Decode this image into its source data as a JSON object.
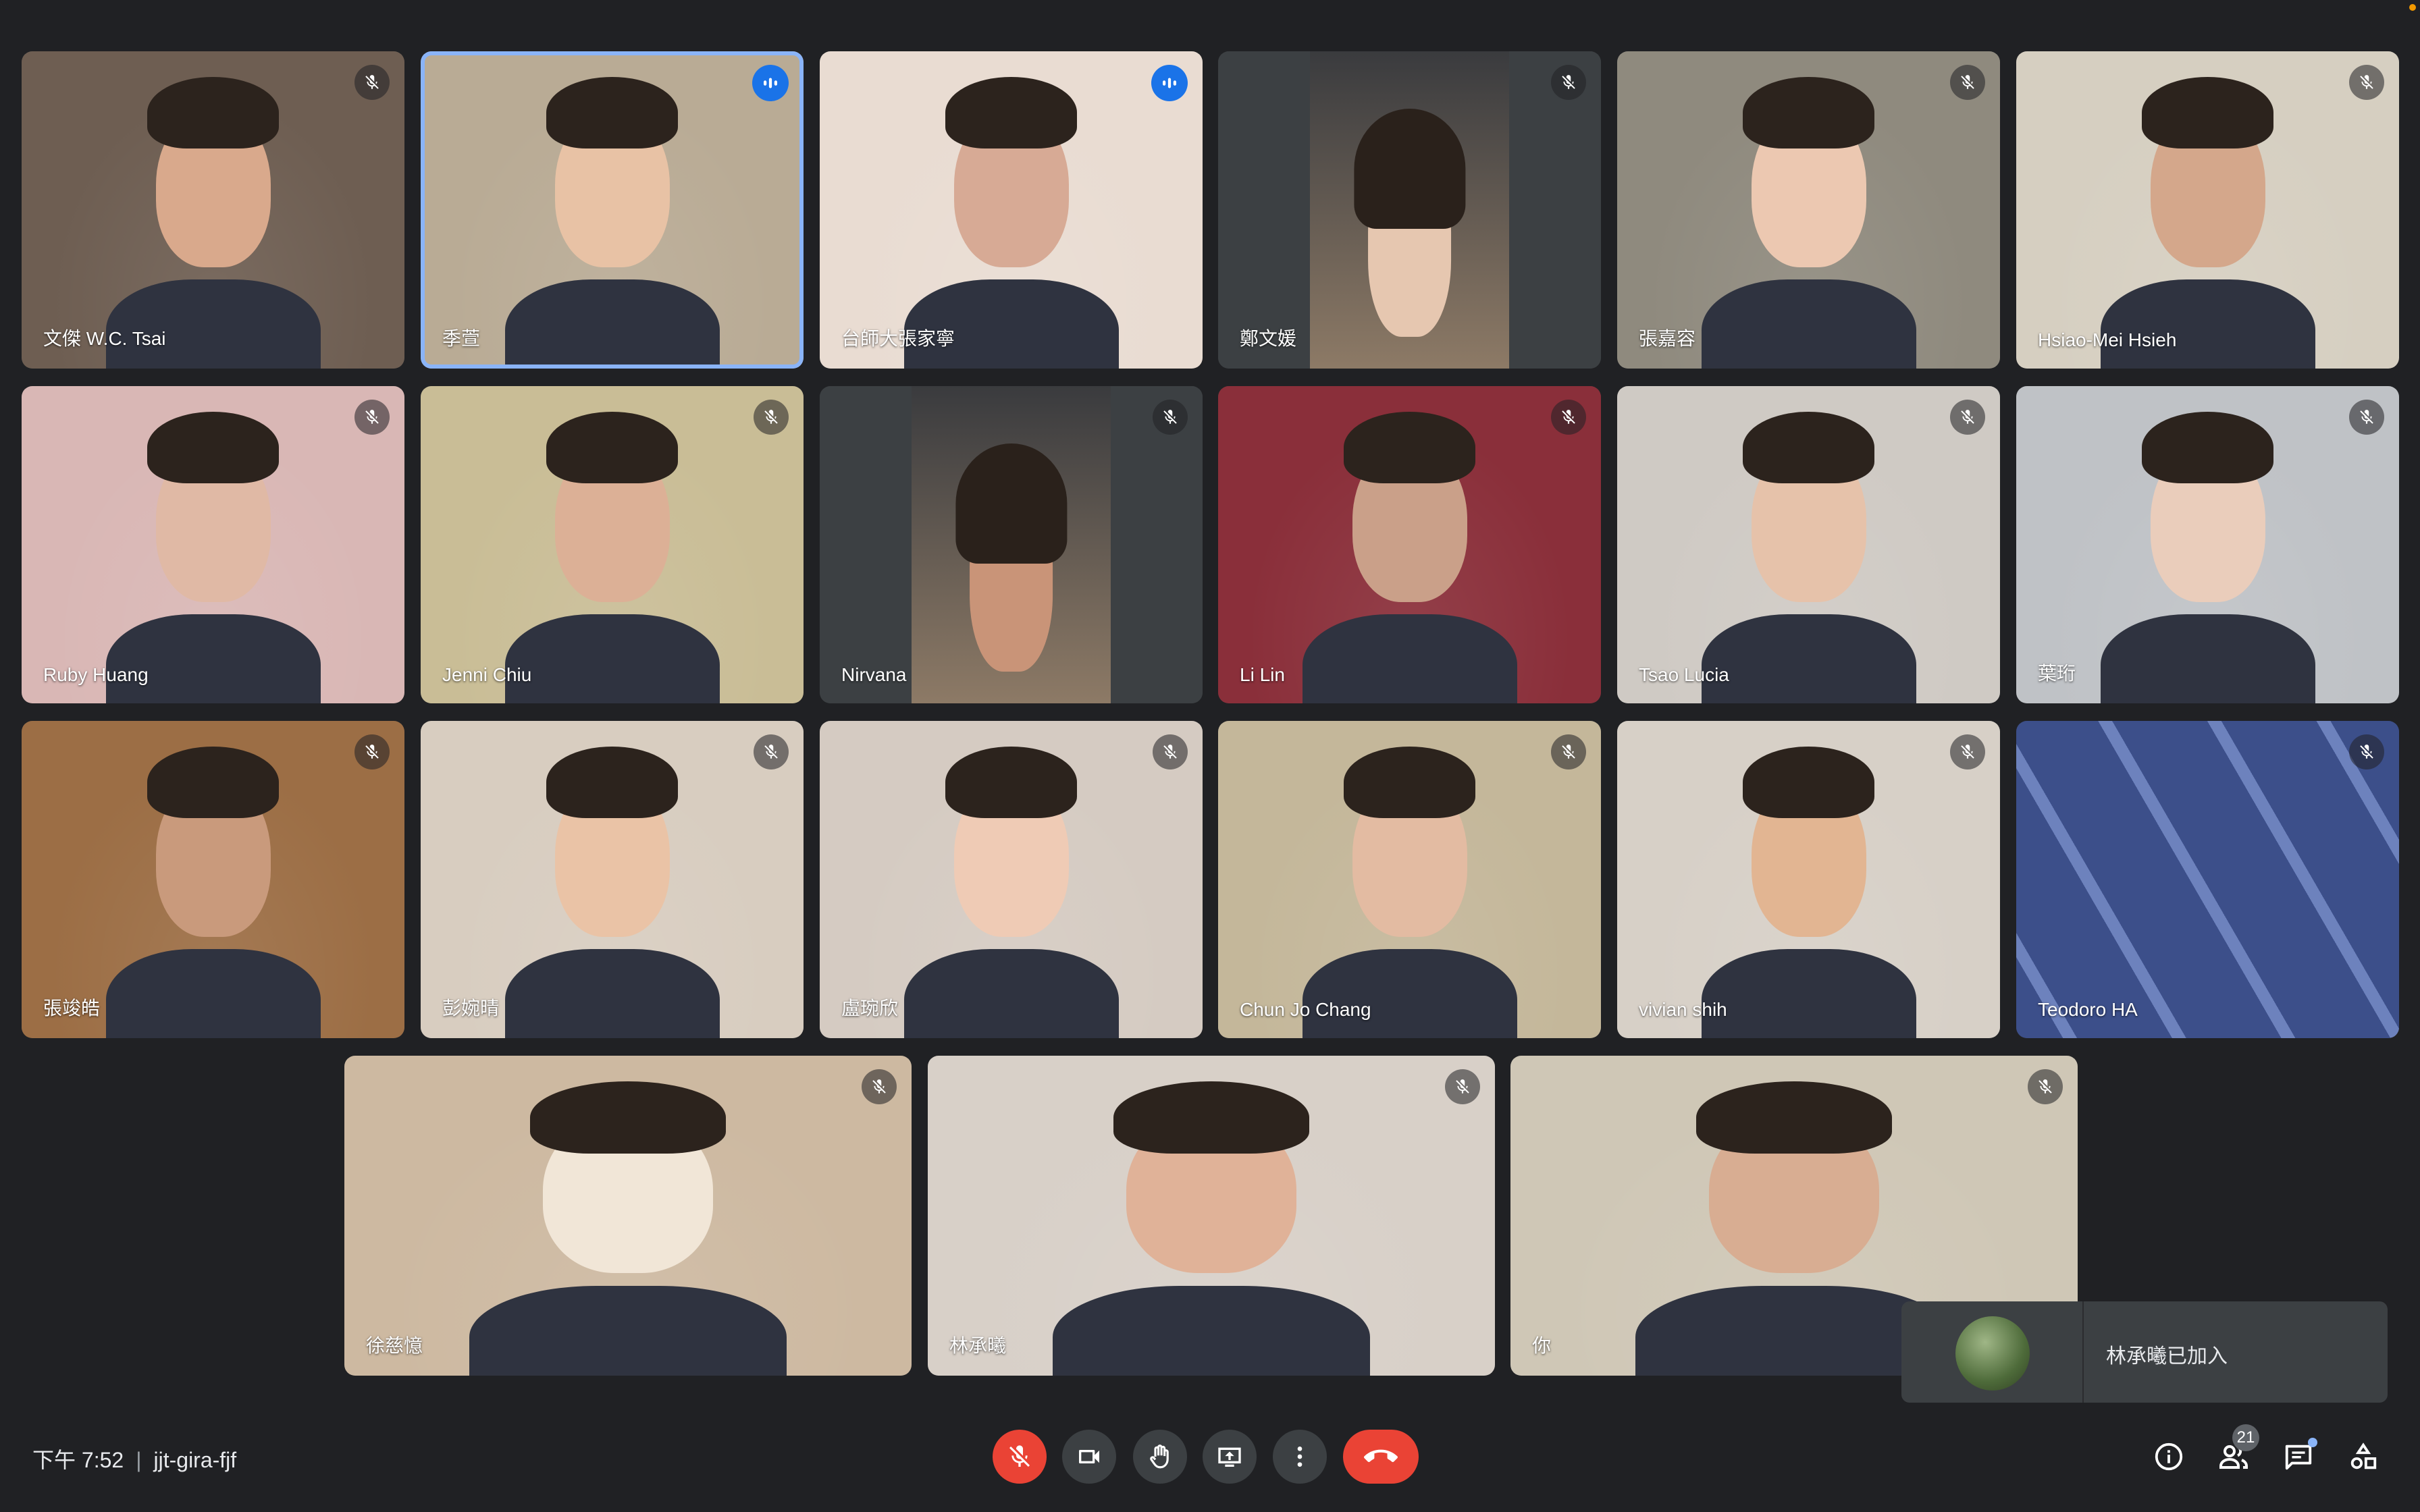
{
  "participants": [
    {
      "name": "文傑 W.C. Tsai",
      "bg": "#6e5e52",
      "skin": "#d9a98c"
    },
    {
      "name": "季萱",
      "bg": "#b9ab95",
      "skin": "#e8c2a5",
      "speaking": true
    },
    {
      "name": "台師大張家寧",
      "bg": "#e9dcd2",
      "skin": "#d7aa95",
      "speaking": true
    },
    {
      "name": "鄭文媛",
      "bg": "#3a3b3e",
      "skin": "#e6c7b0",
      "pillar": true
    },
    {
      "name": "張嘉容",
      "bg": "#8f8a7e",
      "skin": "#ecc8b1"
    },
    {
      "name": "Hsiao-Mei Hsieh",
      "bg": "#d6cfc1",
      "skin": "#d4a78b"
    },
    {
      "name": "Ruby Huang",
      "bg": "#d9b7b5",
      "skin": "#e0b9a5"
    },
    {
      "name": "Jenni Chiu",
      "bg": "#c9bd96",
      "skin": "#dcb096"
    },
    {
      "name": "Nirvana",
      "bg": "#3a3b3e",
      "skin": "#c99478",
      "pillar": true
    },
    {
      "name": "Li Lin",
      "bg": "#8a2f3a",
      "skin": "#caa089"
    },
    {
      "name": "Tsao Lucia",
      "bg": "#cfcac4",
      "skin": "#e6c2aa"
    },
    {
      "name": "葉珩",
      "bg": "#bfc2c6",
      "skin": "#eacdbb"
    },
    {
      "name": "張竣皓",
      "bg": "#9c6e45",
      "skin": "#c99a7c"
    },
    {
      "name": "彭婉晴",
      "bg": "#d8cdc0",
      "skin": "#eac3a6"
    },
    {
      "name": "盧琬欣",
      "bg": "#d5cbc2",
      "skin": "#efcbb5"
    },
    {
      "name": "Chun Jo Chang",
      "bg": "#c4b79a",
      "skin": "#e3bba2"
    },
    {
      "name": "vivian shih",
      "bg": "#d7d0c7",
      "skin": "#e2b592"
    },
    {
      "name": "Teodoro HA",
      "bg": "#3c4f8a",
      "skin": "#c8d3ec",
      "camera_off": true
    },
    {
      "name": "徐慈憶",
      "bg": "#cdb9a1",
      "skin": "#f1e6d7"
    },
    {
      "name": "林承曦",
      "bg": "#d8d0c8",
      "skin": "#e0b298"
    },
    {
      "name": "你",
      "bg": "#cfc7b6",
      "skin": "#d8ad92"
    }
  ],
  "bottom_bar": {
    "time": "下午 7:52",
    "meeting_code": "jjt-gira-fjf",
    "participant_count": "21"
  },
  "toast": {
    "message": "林承曦已加入"
  },
  "icons": [
    "mic-off-icon",
    "camera-icon",
    "raise-hand-icon",
    "present-icon",
    "more-icon",
    "hang-up-icon",
    "info-icon",
    "people-icon",
    "chat-icon",
    "activities-icon"
  ]
}
